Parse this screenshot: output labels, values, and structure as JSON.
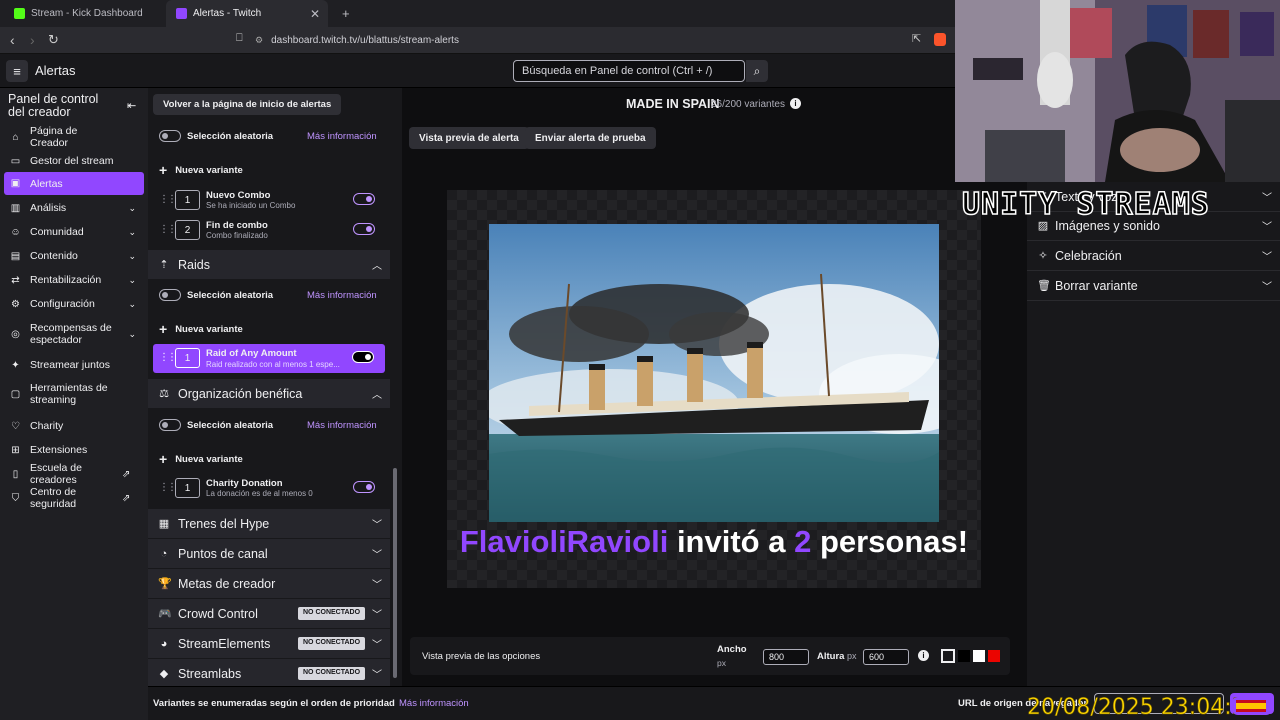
{
  "browser": {
    "tabs": [
      {
        "title": "Stream - Kick Dashboard",
        "color": "#53fc18"
      },
      {
        "title": "Alertas - Twitch",
        "color": "#9147ff"
      }
    ],
    "new_tab": "+",
    "url": "dashboard.twitch.tv/u/blattus/stream-alerts"
  },
  "topnav": {
    "title": "Alertas",
    "search_placeholder": "Búsqueda en Panel de control (Ctrl + /)"
  },
  "sidebar": {
    "header": "Panel de control del creador",
    "items": [
      {
        "label": "Página de Creador",
        "icon": "⌂"
      },
      {
        "label": "Gestor del stream",
        "icon": "▭"
      },
      {
        "label": "Alertas",
        "icon": "▣",
        "active": true
      },
      {
        "label": "Análisis",
        "icon": "▥",
        "chevron": true
      },
      {
        "label": "Comunidad",
        "icon": "☺",
        "chevron": true
      },
      {
        "label": "Contenido",
        "icon": "▤",
        "chevron": true
      },
      {
        "label": "Rentabilización",
        "icon": "⇄",
        "chevron": true
      },
      {
        "label": "Configuración",
        "icon": "⚙",
        "chevron": true
      },
      {
        "label": "Recompensas de espectador",
        "icon": "◎",
        "chevron": true
      },
      {
        "label": "Streamear juntos",
        "icon": "✦"
      },
      {
        "label": "Herramientas de streaming",
        "icon": "▢"
      },
      {
        "label": "Charity",
        "icon": "♡"
      },
      {
        "label": "Extensiones",
        "icon": "⊞"
      },
      {
        "label": "Escuela de creadores",
        "icon": "▯",
        "external": true
      },
      {
        "label": "Centro de seguridad",
        "icon": "⛉",
        "external": true
      }
    ]
  },
  "middle": {
    "back_button": "Volver a la página de inicio de alertas",
    "random_label": "Selección aleatoria",
    "more_info": "Más información",
    "new_variant": "Nueva variante",
    "combo_variants": [
      {
        "num": "1",
        "title": "Nuevo Combo",
        "sub": "Se ha iniciado un Combo"
      },
      {
        "num": "2",
        "title": "Fin de combo",
        "sub": "Combo finalizado"
      }
    ],
    "raids": {
      "title": "Raids",
      "variant": {
        "num": "1",
        "title": "Raid of Any Amount",
        "sub": "Raid realizado con al menos 1 espe..."
      }
    },
    "charity": {
      "title": "Organización benéfica",
      "variant": {
        "num": "1",
        "title": "Charity Donation",
        "sub": "La donación es de al menos 0"
      }
    },
    "collapsed_sections": [
      {
        "title": "Trenes del Hype",
        "icon": "▦"
      },
      {
        "title": "Puntos de canal",
        "icon": "◔"
      },
      {
        "title": "Metas de creador",
        "icon": "🏆"
      },
      {
        "title": "Crowd Control",
        "icon": "🎮",
        "badge": "NO CONECTADO"
      },
      {
        "title": "StreamElements",
        "icon": "◕",
        "badge": "NO CONECTADO"
      },
      {
        "title": "Streamlabs",
        "icon": "◆",
        "badge": "NO CONECTADO"
      }
    ]
  },
  "preview": {
    "heading": "MADE IN SPAIN",
    "variants_count": "26/200 variantes",
    "preview_btn": "Vista previa de alerta",
    "test_btn": "Enviar alerta de prueba",
    "alert_user": "FlavioliRavioli",
    "alert_text1": " invitó a ",
    "alert_count": "2",
    "alert_text2": " personas!",
    "options_label": "Vista previa de las opciones",
    "width_label": "Ancho",
    "width_unit": "px",
    "width_value": "800",
    "height_label": "Altura",
    "height_unit": "px",
    "height_value": "600",
    "swatches": [
      "#18181b",
      "#000000",
      "#ffffff",
      "#eb0400"
    ]
  },
  "right_panel": {
    "items": [
      {
        "label": "Texto y voz",
        "icon": "T"
      },
      {
        "label": "Imágenes y sonido",
        "icon": "▨"
      },
      {
        "label": "Celebración",
        "icon": "✧"
      },
      {
        "label": "Borrar variante",
        "icon": "🗑"
      }
    ]
  },
  "footer": {
    "note": "Variantes se enumeradas según el orden de prioridad",
    "more_info": "Más información",
    "url_label": "URL de origen de navegador"
  },
  "overlay": {
    "brand": "UNITY STREAMS",
    "timestamp": "20/08/2025 23:04:38"
  }
}
